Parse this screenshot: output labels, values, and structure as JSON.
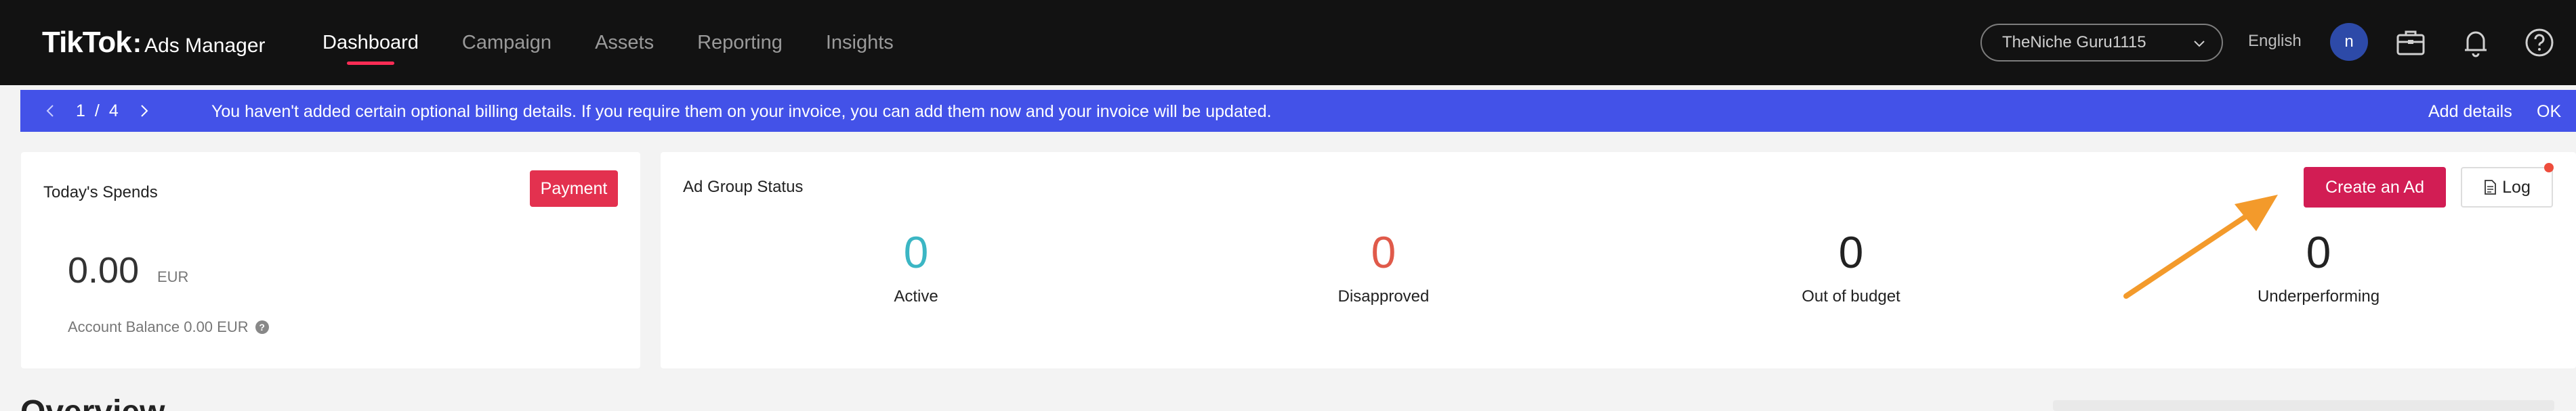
{
  "brand": {
    "name": "TikTok",
    "separator": ":",
    "product": "Ads Manager"
  },
  "nav": {
    "items": [
      "Dashboard",
      "Campaign",
      "Assets",
      "Reporting",
      "Insights"
    ],
    "active": "Dashboard"
  },
  "header": {
    "account_name": "TheNiche Guru1115",
    "language": "English",
    "avatar_letter": "n"
  },
  "banner": {
    "page_current": "1",
    "page_separator": "/",
    "page_total": "4",
    "message": "You haven't added certain optional billing details. If you require them on your invoice, you can add them now and your invoice will be updated.",
    "add_details_label": "Add details",
    "ok_label": "OK",
    "color": "#4352e8"
  },
  "spends": {
    "title": "Today's Spends",
    "payment_label": "Payment",
    "amount": "0.00",
    "currency": "EUR",
    "balance_text": "Account Balance 0.00 EUR"
  },
  "ad_group_status": {
    "title": "Ad Group Status",
    "create_label": "Create an Ad",
    "log_label": "Log",
    "metrics": [
      {
        "label": "Active",
        "value": "0",
        "color": "#3bb6c4"
      },
      {
        "label": "Disapproved",
        "value": "0",
        "color": "#e05a4a"
      },
      {
        "label": "Out of budget",
        "value": "0",
        "color": "#222222"
      },
      {
        "label": "Underperforming",
        "value": "0",
        "color": "#222222"
      }
    ]
  },
  "overview": {
    "title": "Overview"
  },
  "colors": {
    "accent": "#fe2c55",
    "create_button": "#d21d54",
    "payment_button": "#e3314f",
    "annotation_arrow": "#f39a2b"
  }
}
